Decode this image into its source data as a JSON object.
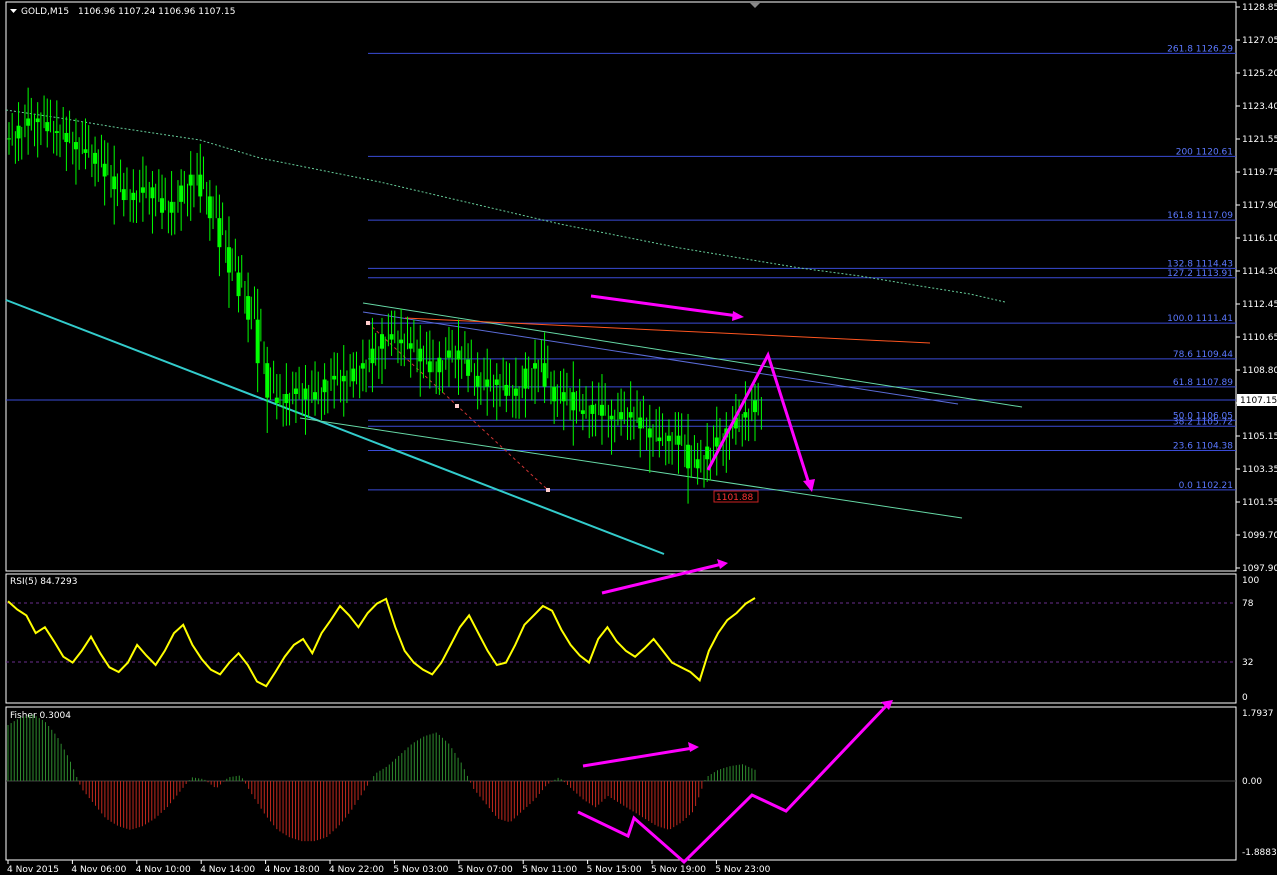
{
  "header": {
    "symbol": "GOLD,M15",
    "ohlc": "1106.96 1107.24 1106.96 1107.15"
  },
  "colors": {
    "background": "#000000",
    "candles": "#00ff00",
    "fib_lines": "#3a4bd6",
    "fib_text": "#5b78ff",
    "rsi_line": "#ffff00",
    "fisher_up": "#2e8b2e",
    "fisher_down": "#c0281e",
    "arrows": "#ff00ff",
    "channel_cyan": "#33cccc",
    "trend_green": "#66d9a6",
    "trend_orange": "#ff5520",
    "ma_dotted": "#66cc99",
    "retrace_red": "#cc3333",
    "current_price_tag": "#ffffff"
  },
  "price_axis": {
    "ticks": [
      "1128.85",
      "1127.05",
      "1125.20",
      "1123.40",
      "1121.55",
      "1119.75",
      "1117.90",
      "1116.10",
      "1114.30",
      "1112.45",
      "1110.65",
      "1108.80",
      "1107.00",
      "1105.15",
      "1103.35",
      "1101.55",
      "1099.70",
      "1097.90"
    ],
    "current_price": "1107.15"
  },
  "time_axis": {
    "labels": [
      "4 Nov 2015",
      "4 Nov 06:00",
      "4 Nov 10:00",
      "4 Nov 14:00",
      "4 Nov 18:00",
      "4 Nov 22:00",
      "5 Nov 03:00",
      "5 Nov 07:00",
      "5 Nov 11:00",
      "5 Nov 15:00",
      "5 Nov 19:00",
      "5 Nov 23:00"
    ]
  },
  "fibonacci": {
    "levels": [
      {
        "label": "261.8 1126.29",
        "price": 1126.29
      },
      {
        "label": "200 1120.61",
        "price": 1120.61
      },
      {
        "label": "161.8 1117.09",
        "price": 1117.09
      },
      {
        "label": "132.8 1114.43",
        "price": 1114.43
      },
      {
        "label": "127.2 1113.91",
        "price": 1113.91
      },
      {
        "label": "100.0 1111.41",
        "price": 1111.41
      },
      {
        "label": "78.6 1109.44",
        "price": 1109.44
      },
      {
        "label": "61.8 1107.89",
        "price": 1107.89
      },
      {
        "label": "50.0 1106.05",
        "price": 1106.05
      },
      {
        "label": "38.2 1105.72",
        "price": 1105.72
      },
      {
        "label": "23.6 1104.38",
        "price": 1104.38
      },
      {
        "label": "0.0 1102.21",
        "price": 1102.21
      }
    ],
    "low_marker": "1101.88"
  },
  "rsi": {
    "label": "RSI(5) 84.7293",
    "scale_labels": [
      "100",
      "78",
      "32",
      "0"
    ],
    "levels": [
      78,
      32
    ]
  },
  "fisher": {
    "label": "Fisher 0.3004",
    "scale_labels": [
      "1.7937",
      "0.00",
      "-1.8883"
    ],
    "max": 1.7937,
    "min": -1.8883
  },
  "chart_data": {
    "type": "candlestick",
    "title": "GOLD,M15",
    "xlabel": "",
    "ylabel": "",
    "ylim": [
      1097.9,
      1128.85
    ],
    "x_labels": [
      "4 Nov 2015",
      "4 Nov 06:00",
      "4 Nov 10:00",
      "4 Nov 14:00",
      "4 Nov 18:00",
      "4 Nov 22:00",
      "5 Nov 03:00",
      "5 Nov 07:00",
      "5 Nov 11:00",
      "5 Nov 15:00",
      "5 Nov 19:00",
      "5 Nov 23:00"
    ],
    "close_trace": [
      1121.6,
      1122.3,
      1122.7,
      1122.5,
      1122.0,
      1121.9,
      1121.4,
      1121.0,
      1120.8,
      1120.2,
      1119.5,
      1118.8,
      1118.2,
      1118.6,
      1118.9,
      1118.3,
      1117.5,
      1118.1,
      1119.0,
      1119.6,
      1118.4,
      1117.2,
      1115.6,
      1114.2,
      1112.9,
      1111.6,
      1109.2,
      1107.3,
      1107.0,
      1107.5,
      1107.8,
      1107.2,
      1107.6,
      1108.3,
      1108.5,
      1108.2,
      1108.9,
      1109.2,
      1110.0,
      1110.8,
      1110.5,
      1110.3,
      1110.0,
      1109.3,
      1108.7,
      1109.5,
      1109.9,
      1109.4,
      1108.5,
      1107.9,
      1108.3,
      1108.0,
      1107.4,
      1107.8,
      1108.9,
      1109.2,
      1107.9,
      1107.1,
      1107.6,
      1106.6,
      1106.4,
      1106.9,
      1106.3,
      1106.1,
      1106.5,
      1106.2,
      1105.6,
      1105.1,
      1104.9,
      1105.2,
      1104.7,
      1103.4,
      1103.9,
      1104.6,
      1105.1,
      1105.6,
      1106.2,
      1106.5,
      1107.15
    ],
    "fib_levels": [
      1126.29,
      1120.61,
      1117.09,
      1114.43,
      1113.91,
      1111.41,
      1109.44,
      1107.89,
      1106.05,
      1105.72,
      1104.38,
      1102.21
    ],
    "rsi_trace": [
      82,
      75,
      70,
      55,
      60,
      48,
      35,
      30,
      40,
      52,
      38,
      26,
      22,
      30,
      45,
      36,
      28,
      40,
      55,
      62,
      45,
      33,
      24,
      20,
      30,
      38,
      28,
      14,
      10,
      22,
      35,
      45,
      50,
      38,
      55,
      66,
      78,
      70,
      60,
      72,
      80,
      84,
      60,
      40,
      30,
      24,
      20,
      30,
      45,
      60,
      70,
      55,
      40,
      28,
      30,
      45,
      62,
      70,
      78,
      74,
      58,
      45,
      36,
      30,
      50,
      60,
      48,
      40,
      35,
      42,
      50,
      40,
      30,
      26,
      22,
      15,
      40,
      55,
      66,
      72,
      80,
      84.73
    ],
    "fisher_trace": [
      1.5,
      1.7,
      1.79,
      1.6,
      1.2,
      0.6,
      -0.2,
      -0.6,
      -1.0,
      -1.2,
      -1.3,
      -1.2,
      -1.0,
      -0.7,
      -0.3,
      0.1,
      0.05,
      -0.2,
      0.1,
      0.15,
      -0.4,
      -0.9,
      -1.3,
      -1.5,
      -1.6,
      -1.6,
      -1.5,
      -1.2,
      -0.8,
      -0.3,
      0.2,
      0.4,
      0.7,
      1.0,
      1.2,
      1.3,
      1.0,
      0.5,
      -0.2,
      -0.6,
      -1.0,
      -1.1,
      -0.8,
      -0.5,
      -0.1,
      0.1,
      -0.2,
      -0.5,
      -0.7,
      -0.4,
      -0.6,
      -0.8,
      -1.0,
      -1.2,
      -1.3,
      -1.1,
      -0.8,
      0.1,
      0.3,
      0.4,
      0.45,
      0.3004
    ]
  }
}
